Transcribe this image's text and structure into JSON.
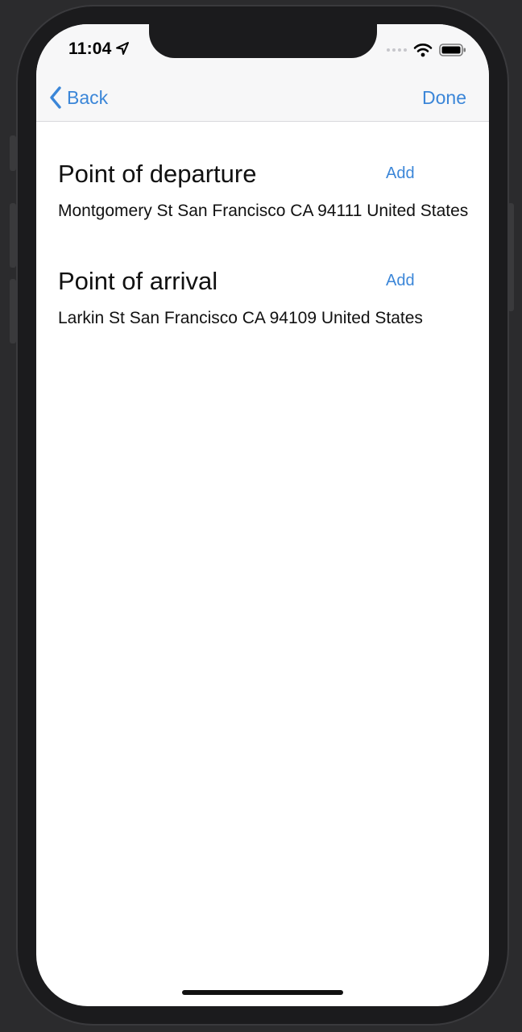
{
  "status_bar": {
    "time": "11:04",
    "location_icon": "location-arrow-icon",
    "wifi_icon": "wifi-icon",
    "battery_icon": "battery-icon"
  },
  "nav": {
    "back_label": "Back",
    "done_label": "Done"
  },
  "departure": {
    "title": "Point of departure",
    "add_label": "Add",
    "address": "Montgomery St San Francisco CA 94111 United States"
  },
  "arrival": {
    "title": "Point of arrival",
    "add_label": "Add",
    "address": "Larkin St San Francisco CA 94109 United States"
  },
  "colors": {
    "accent": "#3b86d8",
    "nav_background": "#f7f7f8",
    "text": "#111111"
  }
}
